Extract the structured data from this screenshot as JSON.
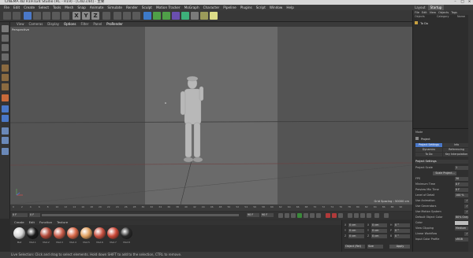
{
  "window": {
    "title": "CINEMA 4D R19.024 Studio (RC - R19) - [C4D.c4d] - 主要"
  },
  "menu": [
    "File",
    "Edit",
    "Create",
    "Select",
    "Tools",
    "Mesh",
    "Snap",
    "Animate",
    "Simulate",
    "Render",
    "Sculpt",
    "Motion Tracker",
    "MoGraph",
    "Character",
    "Pipeline",
    "Plugins",
    "Script",
    "Window",
    "Help"
  ],
  "right_tabs": [
    "Layout",
    "Startup"
  ],
  "viewport": {
    "menu": [
      "View",
      "Cameras",
      "Display",
      "Options",
      "Filter",
      "Panel",
      "ProRender"
    ],
    "label": "Perspective",
    "grid_spacing": "Grid Spacing : 50000 cm"
  },
  "timeline": {
    "ticks": [
      "0",
      "2",
      "4",
      "6",
      "8",
      "10",
      "12",
      "14",
      "16",
      "18",
      "20",
      "22",
      "24",
      "26",
      "28",
      "30",
      "32",
      "34",
      "36",
      "38",
      "40",
      "42",
      "44",
      "46",
      "48",
      "50",
      "52",
      "54",
      "56",
      "58",
      "60",
      "62",
      "64",
      "66",
      "68",
      "70",
      "72",
      "74",
      "76",
      "78",
      "80",
      "82",
      "84",
      "86",
      "88",
      "90"
    ],
    "current_frame": "0 F",
    "start_frame": "0 F",
    "end_frame": "90 F",
    "max_frame": "90 F"
  },
  "material_manager": {
    "tabs": [
      "Create",
      "Edit",
      "Function",
      "Texture"
    ],
    "materials": [
      {
        "label": "Mat",
        "color": "#d8d8d8"
      },
      {
        "label": "Mat.1",
        "color": "#1a1a1a"
      },
      {
        "label": "Mat.2",
        "color": "#b24a3a"
      },
      {
        "label": "Mat.3",
        "color": "#c85a48"
      },
      {
        "label": "Mat.4",
        "color": "#d86848"
      },
      {
        "label": "Mat.5",
        "color": "#e0a060"
      },
      {
        "label": "Mat.6",
        "color": "#c85040"
      },
      {
        "label": "Mat.7",
        "color": "#cc4838"
      },
      {
        "label": "Mat.8",
        "color": "#282828"
      }
    ]
  },
  "coordinates": {
    "rows": [
      {
        "a": "X",
        "av": "0 cm",
        "b": "X",
        "bv": "0 cm",
        "c": "H",
        "cv": "0 °"
      },
      {
        "a": "Y",
        "av": "0 cm",
        "b": "Y",
        "bv": "0 cm",
        "c": "P",
        "cv": "0 °"
      },
      {
        "a": "Z",
        "av": "0 cm",
        "b": "Z",
        "bv": "0 cm",
        "c": "B",
        "cv": "0 °"
      }
    ],
    "mode": "Object (Rel)",
    "size_mode": "Size",
    "apply": "Apply"
  },
  "status": "Live Selection: Click and drag to select elements. Hold down SHIFT to add to the selection, CTRL to remove.",
  "objects_panel": {
    "menu": [
      "File",
      "Edit",
      "View",
      "Objects",
      "Tags"
    ],
    "header_left": "Objects",
    "header_mid": "Category",
    "header_right": "Name",
    "row": "To Do"
  },
  "attributes": {
    "mode": "Mode",
    "title": "Project",
    "tabs_row1": [
      "Project Settings",
      "Info"
    ],
    "tabs_row2": [
      "Dynamics",
      "Referencing"
    ],
    "tabs_row3": [
      "To Do",
      "Key Interpolation"
    ],
    "section": "Project Settings",
    "rows": [
      {
        "label": "Project Scale",
        "value": "1"
      },
      {
        "label": "",
        "value": "Scale Project..."
      },
      {
        "label": "FPS",
        "value": "30"
      },
      {
        "label": "Minimum Time",
        "value": "0 F"
      },
      {
        "label": "Preview Min Time",
        "value": "0 F"
      },
      {
        "label": "Level of Detail",
        "value": "100 %"
      },
      {
        "label": "Use Animation",
        "value": "✓"
      },
      {
        "label": "Use Generators",
        "value": "✓"
      },
      {
        "label": "Use Motion System",
        "value": "✓"
      },
      {
        "label": "Default Object Color",
        "value": "80% Gray"
      },
      {
        "label": "Color",
        "value": ""
      },
      {
        "label": "View Clipping",
        "value": "Medium"
      },
      {
        "label": "Linear Workflow",
        "value": "✓"
      },
      {
        "label": "Input Color Profile",
        "value": "sRGB"
      }
    ]
  },
  "colors": {
    "accent": "#4a78c8",
    "viewport_bg": "#545454",
    "safe_area": "#6a6a6a"
  }
}
